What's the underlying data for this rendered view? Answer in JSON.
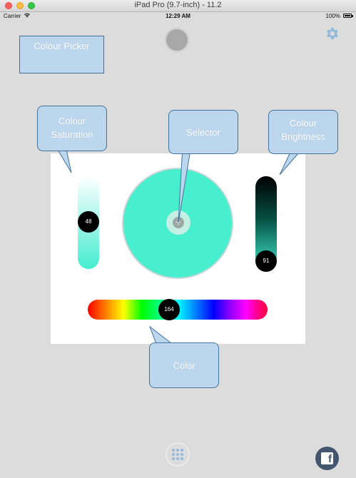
{
  "window": {
    "title": "iPad Pro (9.7-inch) - 11.2"
  },
  "status_bar": {
    "carrier": "Carrier",
    "time": "12:29 AM",
    "battery": "100%"
  },
  "annotations": {
    "title": "Colour Picker",
    "saturation": "Colour Saturation",
    "selector": "Selector",
    "brightness": "Colour Brightness",
    "color": "Color"
  },
  "picker": {
    "saturation_value": "48",
    "brightness_value": "91",
    "hue_value": "164",
    "selected_color": "#47efcf"
  },
  "icons": [
    "settings-gear-icon",
    "grid-menu-icon",
    "facebook-icon",
    "wifi-icon",
    "battery-icon"
  ]
}
